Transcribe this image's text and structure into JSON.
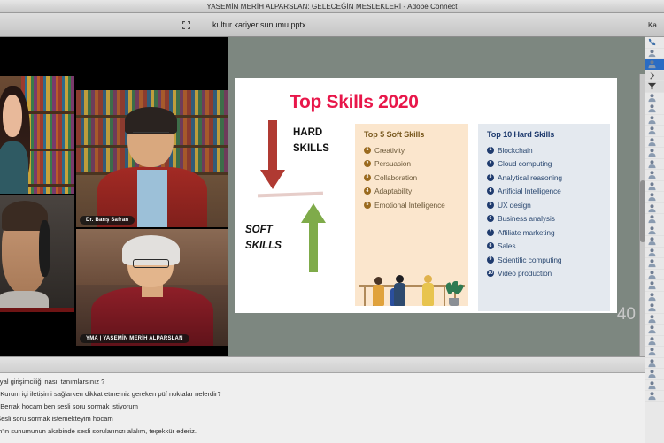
{
  "window": {
    "title": "YASEMİN MERİH ALPARSLAN: GELECEĞİN MESLEKLERİ - Adobe Connect"
  },
  "toolbar": {
    "share_pod_expand_icon": "expand-icon",
    "filename": "kultur kariyer sunumu.pptx",
    "right_expand_icon": "expand-icon",
    "participants_label": "Ka"
  },
  "video_tiles": [
    {
      "name_badge": ""
    },
    {
      "name_badge": ""
    },
    {
      "name_badge": "Dr. Barış Safran"
    },
    {
      "name_badge": "YMA | YASEMİN MERİH ALPARSLAN"
    }
  ],
  "slide": {
    "page_number": "40",
    "title": "Top Skills 2020",
    "title_color": "#e8174a",
    "hard_label_line1": "HARD",
    "hard_label_line2": "SKILLS",
    "soft_label_line1": "SOFT",
    "soft_label_line2": "SKILLS",
    "down_arrow_color": "#b03a32",
    "up_arrow_color": "#7fab4a",
    "soft_box": {
      "heading": "Top 5 Soft Skills",
      "bg": "#fbe6cd",
      "bullet_color": "#9a6a1e",
      "items": [
        {
          "n": "1",
          "label": "Creativity"
        },
        {
          "n": "2",
          "label": "Persuasion"
        },
        {
          "n": "3",
          "label": "Collaboration"
        },
        {
          "n": "4",
          "label": "Adaptability"
        },
        {
          "n": "5",
          "label": "Emotional Intelligence"
        }
      ]
    },
    "hard_box": {
      "heading": "Top 10 Hard Skills",
      "bg": "#e4e9ef",
      "bullet_color": "#1f3b6e",
      "items": [
        {
          "n": "1",
          "label": "Blockchain"
        },
        {
          "n": "2",
          "label": "Cloud computing"
        },
        {
          "n": "3",
          "label": "Analytical reasoning"
        },
        {
          "n": "4",
          "label": "Artificial Intelligence"
        },
        {
          "n": "5",
          "label": "UX design"
        },
        {
          "n": "6",
          "label": "Business analysis"
        },
        {
          "n": "7",
          "label": "Affiliate marketing"
        },
        {
          "n": "8",
          "label": "Sales"
        },
        {
          "n": "9",
          "label": "Scientific computing"
        },
        {
          "n": "10",
          "label": "Video production"
        }
      ]
    }
  },
  "chat": {
    "messages": [
      "syal girişimciliği nasıl tanımlarsınız ?",
      ": Kurum içi  iletişimi sağlarken dikkat etmemiz gereken püf noktalar nelerdir?",
      ": Berrak hocam ben sesli soru sormak istiyorum",
      "Sesli soru sormak istemekteyim hocam",
      "m'ın sunumunun akabinde sesli sorularınızı alalım, teşekkür ederiz."
    ]
  }
}
